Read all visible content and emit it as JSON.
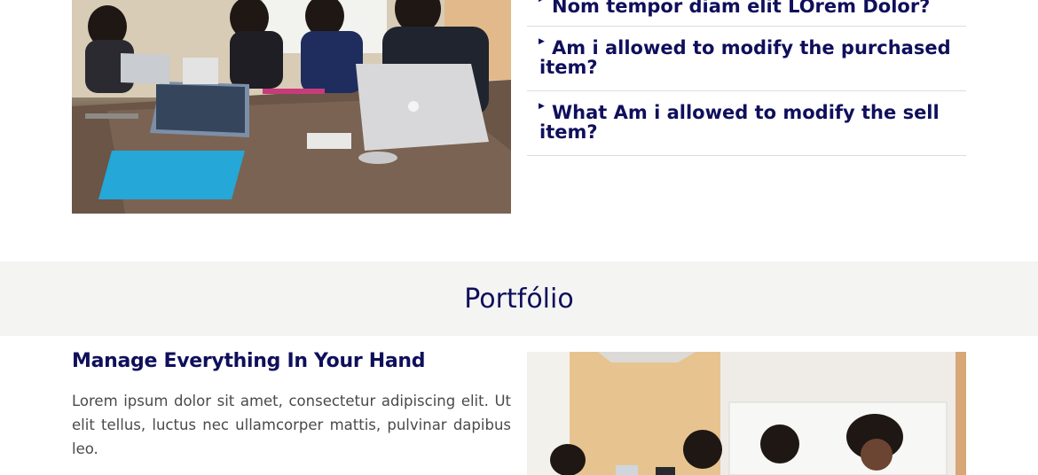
{
  "faq": {
    "items": [
      {
        "question": "Nom tempor diam elit LOrem Dolor?"
      },
      {
        "question": "Am i allowed to modify the purchased item?"
      },
      {
        "question": "What Am i allowed to modify the sell item?"
      }
    ]
  },
  "portfolio": {
    "heading": "Portfólio"
  },
  "feature": {
    "title": "Manage Everything In Your Hand",
    "body": "Lorem ipsum dolor sit amet, consectetur adipiscing elit. Ut elit tellus, luctus nec ullamcorper mattis, pulvinar dapibus leo."
  },
  "colors": {
    "heading": "#0f0f5c",
    "band_background": "#f4f4f2",
    "body_text": "#4a4a4a",
    "divider": "#dcdcdc"
  },
  "icons": {
    "faq_arrow": "caret-right-icon"
  }
}
